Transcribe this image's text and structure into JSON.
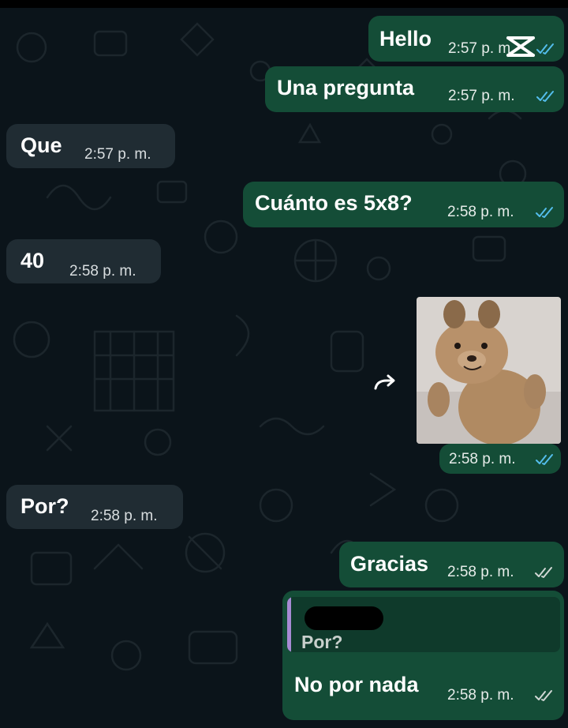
{
  "messages": [
    {
      "text": "Hello",
      "time": "2:57 p. m.",
      "direction": "outgoing",
      "status": "read"
    },
    {
      "text": "Una pregunta",
      "time": "2:57 p. m.",
      "direction": "outgoing",
      "status": "read"
    },
    {
      "text": "Que",
      "time": "2:57 p. m.",
      "direction": "incoming"
    },
    {
      "text": "Cuánto es 5x8?",
      "time": "2:58 p. m.",
      "direction": "outgoing",
      "status": "read"
    },
    {
      "text": "40",
      "time": "2:58 p. m.",
      "direction": "incoming"
    },
    {
      "time": "2:58 p. m.",
      "direction": "outgoing",
      "type": "sticker",
      "status": "read"
    },
    {
      "text": "Por?",
      "time": "2:58 p. m.",
      "direction": "incoming"
    },
    {
      "text": "Gracias",
      "time": "2:58 p. m.",
      "direction": "outgoing",
      "status": "delivered"
    },
    {
      "text": "No por nada",
      "time": "2:58 p. m.",
      "direction": "outgoing",
      "status": "delivered",
      "reply_to": {
        "text": "Por?"
      }
    }
  ],
  "colors": {
    "background": "#0b141a",
    "outgoing_bubble": "#144d37",
    "incoming_bubble": "#202c33",
    "read_ticks": "#53bdeb",
    "delivered_ticks": "#d0d7d4",
    "reply_bar": "#a78bd4"
  },
  "icons": {
    "read": "double-check-blue-icon",
    "delivered": "double-check-grey-icon",
    "forward": "forward-arrow-icon",
    "watermark": "capcut-logo-icon"
  }
}
